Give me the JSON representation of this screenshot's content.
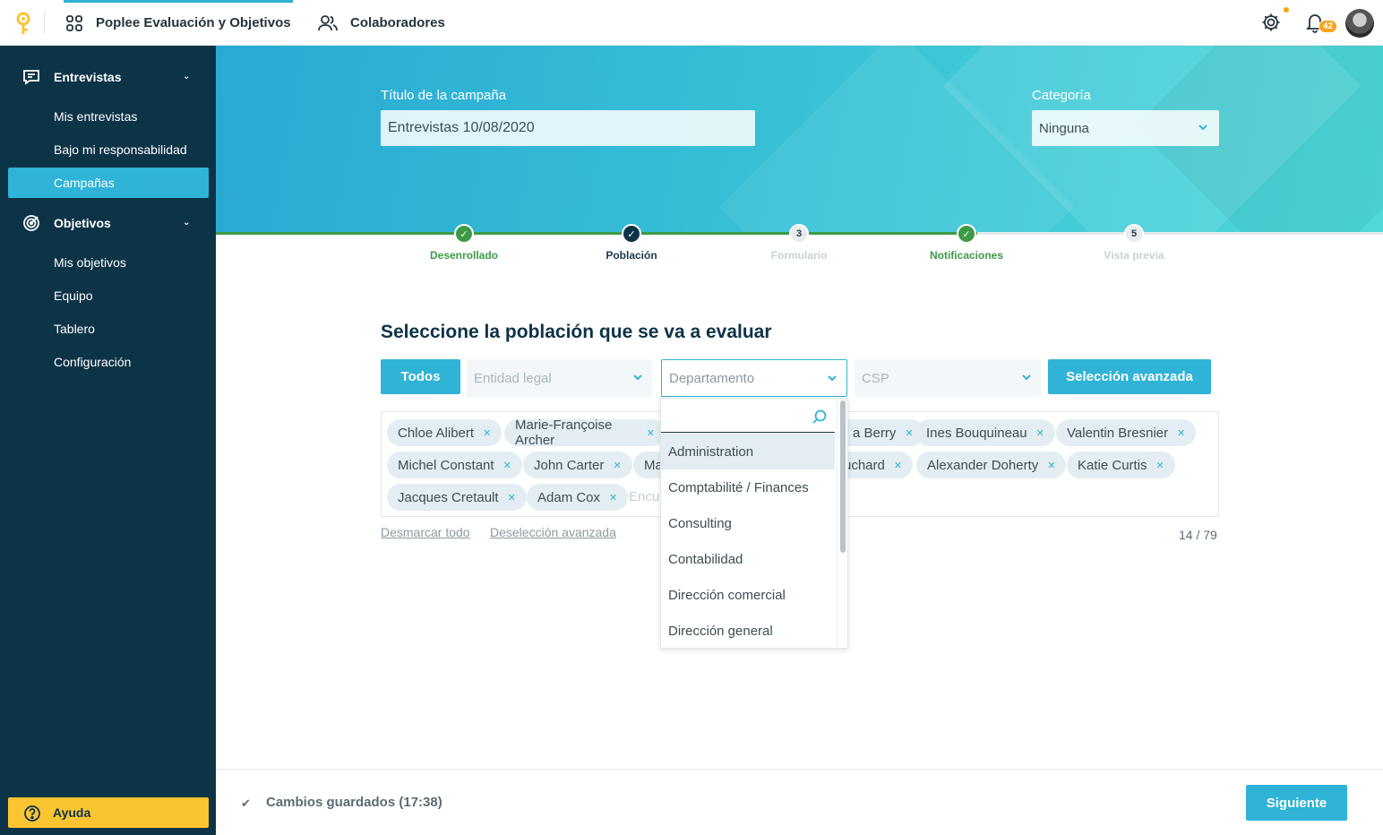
{
  "topbar": {
    "nav": [
      {
        "label": "Poplee Evaluación y Objetivos",
        "icon": "grid-icon",
        "active": true
      },
      {
        "label": "Colaboradores",
        "icon": "users-icon",
        "active": false
      }
    ],
    "notifications_count": "42"
  },
  "sidebar": {
    "sections": [
      {
        "label": "Entrevistas",
        "icon": "chat-icon",
        "items": [
          "Mis entrevistas",
          "Bajo mi responsabilidad",
          "Campañas"
        ],
        "active_item": "Campañas"
      },
      {
        "label": "Objetivos",
        "icon": "target-icon",
        "items": [
          "Mis objetivos",
          "Equipo",
          "Tablero",
          "Configuración"
        ]
      }
    ],
    "help_label": "Ayuda"
  },
  "campaign": {
    "title_label": "Título de la campaña",
    "title_value": "Entrevistas 10/08/2020",
    "category_label": "Categoría",
    "category_value": "Ninguna"
  },
  "steps": [
    {
      "num": "",
      "label": "Desenrollado",
      "state": "done"
    },
    {
      "num": "",
      "label": "Población",
      "state": "current"
    },
    {
      "num": "3",
      "label": "Formulario",
      "state": "pending"
    },
    {
      "num": "",
      "label": "Notificaciones",
      "state": "done"
    },
    {
      "num": "5",
      "label": "Vista previa",
      "state": "pending"
    }
  ],
  "population": {
    "heading": "Seleccione la población que se va a evaluar",
    "all_button": "Todos",
    "filters": {
      "legal_entity": "Entidad legal",
      "department": "Departamento",
      "csp": "CSP"
    },
    "advanced_button": "Selección avanzada",
    "tags": [
      "Chloe Alibert",
      "Marie-Françoise Archer",
      "a Berry",
      "Ines Bouquineau",
      "Valentin Bresnier",
      "Michel Constant",
      "John Carter",
      "Ma",
      "uchard",
      "Alexander Doherty",
      "Katie Curtis",
      "Jacques Cretault",
      "Adam Cox"
    ],
    "tag_input_placeholder": "Encue",
    "unselect_all": "Desmarcar todo",
    "advanced_unselect": "Deselección avanzada",
    "count": "14 / 79"
  },
  "department_dropdown": {
    "search_value": "",
    "options": [
      "Administration",
      "Comptabilité / Finances",
      "Consulting",
      "Contabilidad",
      "Dirección comercial",
      "Dirección general"
    ],
    "highlighted": "Administration"
  },
  "footer": {
    "saved_text": "Cambios guardados (17:38)",
    "next_button": "Siguiente"
  }
}
